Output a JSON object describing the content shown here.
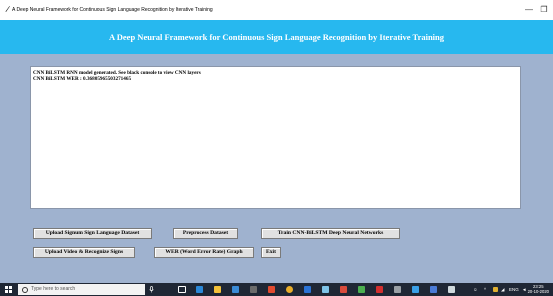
{
  "window": {
    "title": "A Deep Neural Framework for Continuous Sign Language Recognition by Iterative Training",
    "minimize_glyph": "—",
    "restore_glyph": "❐"
  },
  "header": {
    "title": "A Deep Neural Framework for Continuous Sign Language Recognition by Iterative Training"
  },
  "console": {
    "lines": [
      "CNN BiLSTM RNN model generated. See black console to view CNN layers",
      "CNN BiLSTM WER : 0.36805965503271465"
    ]
  },
  "buttons": {
    "upload_dataset": "Upload Signum Sign Language Dataset",
    "preprocess": "Preprocess Dataset",
    "train": "Train CNN-BiLSTM Deep Neural Networks",
    "upload_video": "Upload Video & Recognize Signs",
    "wer_graph": "WER (Word Error Rate) Graph",
    "exit": "Exit"
  },
  "taskbar": {
    "search_placeholder": "Type here to search",
    "time": "23:25",
    "date": "20-10-2020",
    "language": "ENG"
  },
  "colors": {
    "header_bg": "#27b8ef",
    "content_bg": "#9fb2cf",
    "taskbar_bg": "#1f2735"
  }
}
